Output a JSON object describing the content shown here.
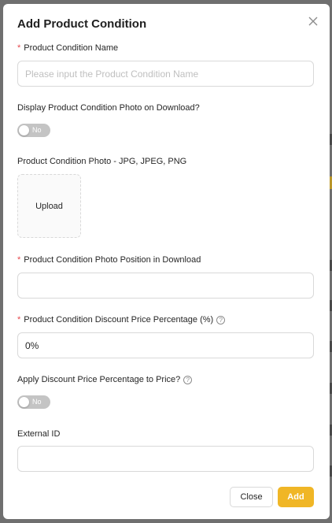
{
  "modal": {
    "title": "Add Product Condition",
    "close_icon": "close-icon"
  },
  "fields": {
    "name": {
      "label": "Product Condition Name",
      "required": true,
      "placeholder": "Please input the Product Condition Name",
      "value": ""
    },
    "display_photo": {
      "label": "Display Product Condition Photo on Download?",
      "toggle_text": "No",
      "on": false
    },
    "photo": {
      "label": "Product Condition Photo - JPG, JPEG, PNG",
      "upload_label": "Upload"
    },
    "photo_position": {
      "label": "Product Condition Photo Position in Download",
      "required": true,
      "value": ""
    },
    "discount": {
      "label": "Product Condition Discount Price Percentage (%)",
      "required": true,
      "help_icon": "question-circle-icon",
      "value": "0%"
    },
    "apply_discount": {
      "label": "Apply Discount Price Percentage to Price?",
      "help_icon": "question-circle-icon",
      "toggle_text": "No",
      "on": false
    },
    "external_id": {
      "label": "External ID",
      "value": ""
    }
  },
  "footer": {
    "close_label": "Close",
    "add_label": "Add"
  },
  "colors": {
    "primary": "#f0b626",
    "required": "#e5484d",
    "toggle_off": "#c4c4c4"
  }
}
